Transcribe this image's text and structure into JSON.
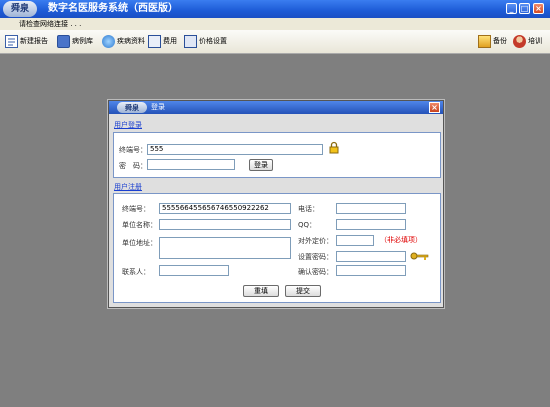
{
  "window": {
    "logo_text": "舜泉",
    "title": "数字名医服务系统（西医版）",
    "controls": {
      "minimize": "_",
      "maximize": "□",
      "close": "×"
    }
  },
  "status": {
    "connection_text": "请检查网络连接 . . ."
  },
  "toolbar": {
    "items": [
      {
        "label": "新建报告",
        "icon": "new-report-icon"
      },
      {
        "label": "病例库",
        "icon": "case-library-icon"
      },
      {
        "label": "疾病资料",
        "icon": "disease-info-icon"
      },
      {
        "label": "费用",
        "icon": "fee-icon"
      },
      {
        "label": "价格设置",
        "icon": "price-settings-icon"
      }
    ],
    "right_items": [
      {
        "label": "备份",
        "icon": "backup-icon"
      },
      {
        "label": "培训",
        "icon": "training-icon"
      }
    ]
  },
  "dialog": {
    "logo_text": "舜泉",
    "title": "登录",
    "close": "×",
    "login": {
      "section_title": "用户登录",
      "terminal_label": "终端号：",
      "terminal_value": "555",
      "password_label": "密　码：",
      "password_value": "",
      "login_button": "登录"
    },
    "register": {
      "section_title": "用户注册",
      "terminal_label": "终端号：",
      "terminal_value": "555566455656746550922262",
      "unit_name_label": "单位名称：",
      "unit_address_label": "单位地址：",
      "contact_label": "联系人：",
      "phone_label": "电话：",
      "qq_label": "QQ：",
      "external_price_label": "对外定价：",
      "required_note": "（非必填项）",
      "set_password_label": "设置密码：",
      "confirm_password_label": "确认密码：",
      "reset_button": "重填",
      "submit_button": "提交"
    }
  },
  "colors": {
    "titlebar": "#1d5bd6",
    "workspace": "#7f7f7f",
    "link": "#1a3fd0",
    "required": "#e00000"
  }
}
